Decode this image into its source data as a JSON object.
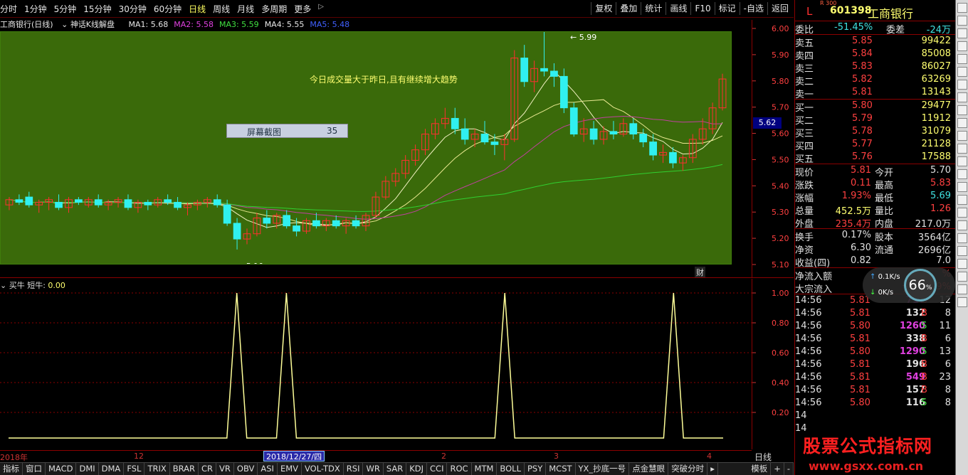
{
  "toolbar": {
    "periods": [
      "分时",
      "1分钟",
      "5分钟",
      "15分钟",
      "30分钟",
      "60分钟",
      "日线",
      "周线",
      "月线",
      "多周期",
      "更多"
    ],
    "active_period": "日线",
    "right_tools": [
      "复权",
      "叠加",
      "统计",
      "画线",
      "F10",
      "标记",
      "-自选",
      "返回"
    ]
  },
  "chart_header": {
    "title": "工商银行(日线)",
    "indicator": "神话K线解盘",
    "ma": [
      {
        "label": "MA1: 5.68",
        "color": "#e6e6e6"
      },
      {
        "label": "MA2: 5.58",
        "color": "#e040e0"
      },
      {
        "label": "MA3: 5.59",
        "color": "#40e040"
      },
      {
        "label": "MA4: 5.55",
        "color": "#e6e6e6"
      },
      {
        "label": "MA5: 5.48",
        "color": "#4060ff"
      }
    ]
  },
  "main_annotations": {
    "note": "今日成交量大于昨日,且有继续增大趋势",
    "screenshot_label": "屏幕截图",
    "screenshot_num": "35",
    "high_label": "5.99",
    "low_label": "5.10",
    "current_price_tag": "5.62",
    "cai_badge": "财"
  },
  "price_axis": [
    "6.00",
    "5.90",
    "5.80",
    "5.70",
    "5.60",
    "5.50",
    "5.40",
    "5.30",
    "5.20",
    "5.10"
  ],
  "sub_axis": [
    "1.00",
    "0.80",
    "0.60",
    "0.40",
    "0.20"
  ],
  "sub_header": {
    "name": "买牛",
    "label": "短牛: ",
    "value": "0.00"
  },
  "date_axis": {
    "labels": [
      {
        "text": "2018年"
      },
      {
        "text": "12"
      },
      {
        "text": "2"
      },
      {
        "text": "3"
      },
      {
        "text": "4"
      }
    ],
    "selected": "2018/12/27/四",
    "period_label": "日线"
  },
  "bottom_tabs": [
    "指标",
    "窗口",
    "MACD",
    "DMI",
    "DMA",
    "FSL",
    "TRIX",
    "BRAR",
    "CR",
    "VR",
    "OBV",
    "ASI",
    "EMV",
    "VOL-TDX",
    "RSI",
    "WR",
    "SAR",
    "KDJ",
    "CCI",
    "ROC",
    "MTM",
    "BOLL",
    "PSY",
    "MCST",
    "YX_抄底一号",
    "点金慧眼",
    "突破分时"
  ],
  "bottom_tabs_right": [
    "模板",
    "+",
    "-"
  ],
  "quote": {
    "code": "601398",
    "name": "工商银行",
    "market_flag": "L",
    "market_sub": "R 300",
    "weibi_label": "委比",
    "weibi": "-51.45%",
    "weicha_label": "委差",
    "weicha": "-24万",
    "asks": [
      {
        "label": "卖五",
        "price": "5.85",
        "vol": "99422"
      },
      {
        "label": "卖四",
        "price": "5.84",
        "vol": "85008"
      },
      {
        "label": "卖三",
        "price": "5.83",
        "vol": "86027"
      },
      {
        "label": "卖二",
        "price": "5.82",
        "vol": "63269"
      },
      {
        "label": "卖一",
        "price": "5.81",
        "vol": "13143"
      }
    ],
    "bids": [
      {
        "label": "买一",
        "price": "5.80",
        "vol": "29477"
      },
      {
        "label": "买二",
        "price": "5.79",
        "vol": "11912"
      },
      {
        "label": "买三",
        "price": "5.78",
        "vol": "31079"
      },
      {
        "label": "买四",
        "price": "5.77",
        "vol": "21128"
      },
      {
        "label": "买五",
        "price": "5.76",
        "vol": "17588"
      }
    ],
    "stats": [
      {
        "l1": "现价",
        "v1": "5.81",
        "c1": "c-red",
        "l2": "今开",
        "v2": "5.70",
        "c2": "c-white"
      },
      {
        "l1": "涨跌",
        "v1": "0.11",
        "c1": "c-red",
        "l2": "最高",
        "v2": "5.83",
        "c2": "c-red"
      },
      {
        "l1": "涨幅",
        "v1": "1.93%",
        "c1": "c-red",
        "l2": "最低",
        "v2": "5.69",
        "c2": "c-cyan"
      },
      {
        "l1": "总量",
        "v1": "452.5万",
        "c1": "c-yellow",
        "l2": "量比",
        "v2": "1.26",
        "c2": "c-red"
      },
      {
        "l1": "外盘",
        "v1": "235.4万",
        "c1": "c-red",
        "l2": "内盘",
        "v2": "217.0万",
        "c2": "c-white"
      }
    ],
    "stats2": [
      {
        "l1": "换手",
        "v1": "0.17%",
        "c1": "c-white",
        "l2": "股本",
        "v2": "3564亿",
        "c2": "c-white"
      },
      {
        "l1": "净资",
        "v1": "6.30",
        "c1": "c-white",
        "l2": "流通",
        "v2": "2696亿",
        "c2": "c-white"
      },
      {
        "l1": "收益(四)",
        "v1": "0.82",
        "c1": "c-white",
        "l2": "",
        "v2": "7.0",
        "c2": "c-white"
      }
    ],
    "flows": [
      {
        "label": "净流入额",
        "v": "",
        "pct": "%"
      },
      {
        "label": "大宗流入",
        "v": "7.67亿",
        "pct": "29%"
      }
    ],
    "ticks": [
      {
        "t": "14:56",
        "p": "5.81",
        "v": "717",
        "d": "B",
        "n": "12",
        "vc": "c-mag"
      },
      {
        "t": "14:56",
        "p": "5.81",
        "v": "132",
        "d": "B",
        "n": "8",
        "vc": "c-white"
      },
      {
        "t": "14:56",
        "p": "5.80",
        "v": "1260",
        "d": "S",
        "n": "11",
        "vc": "c-mag"
      },
      {
        "t": "14:56",
        "p": "5.81",
        "v": "338",
        "d": "B",
        "n": "6",
        "vc": "c-white"
      },
      {
        "t": "14:56",
        "p": "5.80",
        "v": "1290",
        "d": "S",
        "n": "13",
        "vc": "c-mag"
      },
      {
        "t": "14:56",
        "p": "5.81",
        "v": "196",
        "d": "B",
        "n": "6",
        "vc": "c-white"
      },
      {
        "t": "14:56",
        "p": "5.81",
        "v": "549",
        "d": "B",
        "n": "23",
        "vc": "c-mag"
      },
      {
        "t": "14:56",
        "p": "5.81",
        "v": "157",
        "d": "B",
        "n": "8",
        "vc": "c-white"
      },
      {
        "t": "14:56",
        "p": "5.80",
        "v": "116",
        "d": "S",
        "n": "8",
        "vc": "c-white"
      },
      {
        "t": "14",
        "p": "",
        "v": "",
        "d": "",
        "n": "",
        "vc": "c-white"
      },
      {
        "t": "14",
        "p": "",
        "v": "",
        "d": "",
        "n": "",
        "vc": "c-white"
      }
    ]
  },
  "net_badge": {
    "up": "0.1K/s",
    "down": "0K/s",
    "percent": "66",
    "unit": "%"
  },
  "watermark": {
    "line1": "股票公式指标网",
    "line2": "www.gsxx.com.cn"
  },
  "colors": {
    "up": "#ff4040",
    "down": "#40e0e0",
    "chart_bg": "#3a6a0a",
    "signal_line": "#ffff99"
  },
  "chart_data": [
    {
      "type": "candlestick",
      "ylim": [
        5.1,
        6.0
      ],
      "y_ticks": [
        6.0,
        5.9,
        5.8,
        5.7,
        5.6,
        5.5,
        5.4,
        5.3,
        5.2,
        5.1
      ],
      "candles": [
        [
          5.33,
          5.36,
          5.31,
          5.35
        ],
        [
          5.35,
          5.37,
          5.33,
          5.34
        ],
        [
          5.36,
          5.38,
          5.32,
          5.33
        ],
        [
          5.33,
          5.35,
          5.3,
          5.34
        ],
        [
          5.34,
          5.36,
          5.31,
          5.35
        ],
        [
          5.34,
          5.37,
          5.31,
          5.32
        ],
        [
          5.32,
          5.36,
          5.3,
          5.35
        ],
        [
          5.35,
          5.36,
          5.33,
          5.34
        ],
        [
          5.33,
          5.36,
          5.32,
          5.35
        ],
        [
          5.35,
          5.37,
          5.32,
          5.33
        ],
        [
          5.33,
          5.35,
          5.31,
          5.34
        ],
        [
          5.34,
          5.36,
          5.32,
          5.35
        ],
        [
          5.35,
          5.37,
          5.31,
          5.32
        ],
        [
          5.32,
          5.35,
          5.3,
          5.34
        ],
        [
          5.34,
          5.35,
          5.31,
          5.33
        ],
        [
          5.33,
          5.36,
          5.32,
          5.35
        ],
        [
          5.35,
          5.37,
          5.33,
          5.34
        ],
        [
          5.34,
          5.36,
          5.31,
          5.32
        ],
        [
          5.32,
          5.34,
          5.29,
          5.33
        ],
        [
          5.33,
          5.35,
          5.31,
          5.34
        ],
        [
          5.34,
          5.36,
          5.32,
          5.35
        ],
        [
          5.35,
          5.37,
          5.32,
          5.33
        ],
        [
          5.33,
          5.35,
          5.25,
          5.26
        ],
        [
          5.26,
          5.28,
          5.16,
          5.2
        ],
        [
          5.2,
          5.24,
          5.18,
          5.22
        ],
        [
          5.22,
          5.3,
          5.21,
          5.28
        ],
        [
          5.28,
          5.31,
          5.24,
          5.26
        ],
        [
          5.26,
          5.3,
          5.24,
          5.29
        ],
        [
          5.29,
          5.31,
          5.24,
          5.25
        ],
        [
          5.25,
          5.28,
          5.21,
          5.23
        ],
        [
          5.23,
          5.28,
          5.22,
          5.27
        ],
        [
          5.27,
          5.3,
          5.24,
          5.25
        ],
        [
          5.25,
          5.28,
          5.23,
          5.27
        ],
        [
          5.27,
          5.29,
          5.24,
          5.25
        ],
        [
          5.25,
          5.28,
          5.22,
          5.27
        ],
        [
          5.27,
          5.29,
          5.24,
          5.25
        ],
        [
          5.25,
          5.3,
          5.23,
          5.29
        ],
        [
          5.29,
          5.38,
          5.28,
          5.36
        ],
        [
          5.36,
          5.44,
          5.35,
          5.42
        ],
        [
          5.42,
          5.47,
          5.4,
          5.45
        ],
        [
          5.45,
          5.52,
          5.43,
          5.5
        ],
        [
          5.5,
          5.56,
          5.48,
          5.54
        ],
        [
          5.54,
          5.62,
          5.52,
          5.6
        ],
        [
          5.6,
          5.66,
          5.58,
          5.64
        ],
        [
          5.64,
          5.7,
          5.62,
          5.66
        ],
        [
          5.66,
          5.7,
          5.6,
          5.62
        ],
        [
          5.62,
          5.66,
          5.56,
          5.58
        ],
        [
          5.58,
          5.62,
          5.55,
          5.6
        ],
        [
          5.6,
          5.65,
          5.56,
          5.57
        ],
        [
          5.57,
          5.6,
          5.52,
          5.56
        ],
        [
          5.56,
          5.6,
          5.5,
          5.58
        ],
        [
          5.58,
          5.92,
          5.57,
          5.89
        ],
        [
          5.89,
          5.94,
          5.78,
          5.8
        ],
        [
          5.8,
          5.88,
          5.76,
          5.85
        ],
        [
          5.85,
          5.99,
          5.82,
          5.84
        ],
        [
          5.84,
          5.87,
          5.78,
          5.82
        ],
        [
          5.82,
          5.85,
          5.68,
          5.7
        ],
        [
          5.7,
          5.72,
          5.59,
          5.6
        ],
        [
          5.6,
          5.66,
          5.57,
          5.62
        ],
        [
          5.62,
          5.65,
          5.56,
          5.58
        ],
        [
          5.58,
          5.63,
          5.56,
          5.61
        ],
        [
          5.61,
          5.65,
          5.58,
          5.6
        ],
        [
          5.6,
          5.66,
          5.59,
          5.64
        ],
        [
          5.64,
          5.66,
          5.58,
          5.6
        ],
        [
          5.6,
          5.62,
          5.55,
          5.57
        ],
        [
          5.57,
          5.6,
          5.5,
          5.52
        ],
        [
          5.52,
          5.56,
          5.49,
          5.53
        ],
        [
          5.53,
          5.55,
          5.47,
          5.49
        ],
        [
          5.49,
          5.52,
          5.46,
          5.51
        ],
        [
          5.51,
          5.6,
          5.49,
          5.58
        ],
        [
          5.58,
          5.66,
          5.56,
          5.62
        ],
        [
          5.62,
          5.72,
          5.6,
          5.7
        ],
        [
          5.7,
          5.83,
          5.69,
          5.81
        ]
      ]
    },
    {
      "type": "line",
      "ylim": [
        0,
        1
      ],
      "y_ticks": [
        1.0,
        0.8,
        0.6,
        0.4,
        0.2
      ],
      "series": [
        {
          "values": [
            0,
            0,
            0,
            0,
            0,
            0,
            0,
            0,
            0,
            0,
            0,
            0,
            0,
            0,
            0,
            0,
            0,
            0,
            0,
            0,
            0,
            0,
            0,
            1,
            0,
            0,
            0,
            0,
            1,
            0,
            0,
            0,
            0,
            0,
            0,
            0,
            0,
            0,
            0,
            0,
            0,
            0,
            0,
            0,
            0,
            0,
            0,
            0,
            0,
            0,
            1,
            0,
            0,
            0,
            0,
            0,
            0,
            0,
            0,
            0,
            0,
            0,
            0,
            0,
            0,
            0,
            0,
            1,
            0,
            0,
            0,
            0,
            0
          ]
        }
      ]
    }
  ]
}
